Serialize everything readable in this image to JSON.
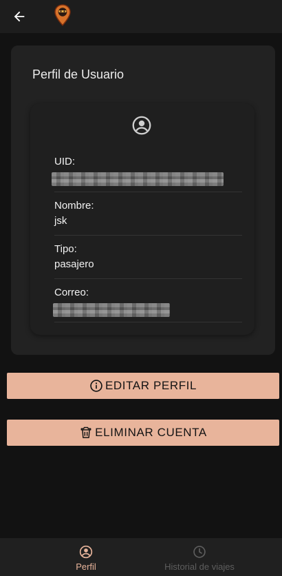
{
  "header": {
    "back_icon": "arrow-left-icon",
    "logo_icon": "app-logo-pin-icon"
  },
  "profile": {
    "title": "Perfil de Usuario",
    "avatar_icon": "account-circle-icon",
    "fields": [
      {
        "label": "UID:",
        "value": "",
        "redacted": true
      },
      {
        "label": "Nombre:",
        "value": "jsk"
      },
      {
        "label": "Tipo:",
        "value": "pasajero"
      },
      {
        "label": "Correo:",
        "value": "",
        "redacted": true
      }
    ]
  },
  "actions": {
    "edit_label": "EDITAR PERFIL",
    "edit_icon": "info-circle-icon",
    "delete_label": "ELIMINAR CUENTA",
    "delete_icon": "trash-icon"
  },
  "bottom_nav": {
    "items": [
      {
        "label": "Perfil",
        "icon": "account-circle-icon",
        "active": true
      },
      {
        "label": "Historial de viajes",
        "icon": "clock-icon",
        "active": false
      }
    ]
  },
  "colors": {
    "background": "#121212",
    "card": "#222222",
    "accent": "#e8b49b",
    "nav_active": "#e8b49b",
    "nav_inactive": "#5e5e5e"
  }
}
